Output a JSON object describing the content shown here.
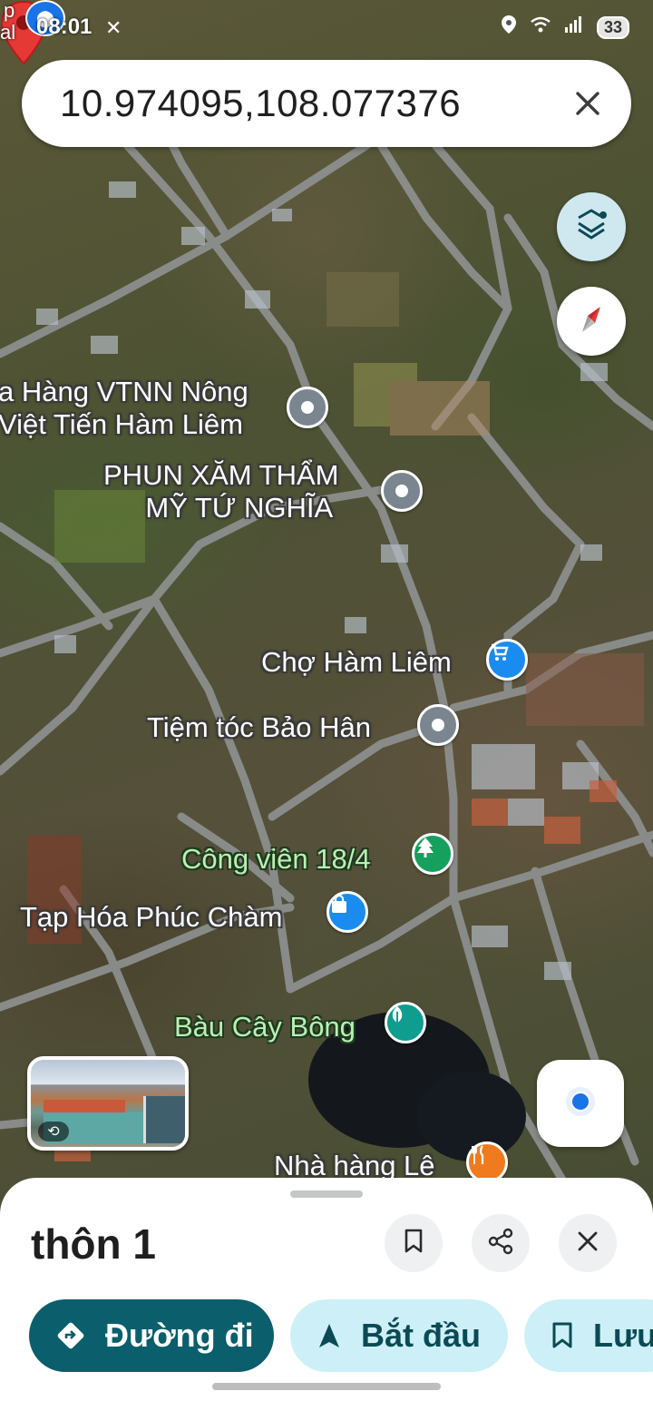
{
  "status_bar": {
    "time": "08:01",
    "crumb_top": "p",
    "crumb_bottom": "al",
    "battery": "33"
  },
  "search": {
    "query": "10.974095,108.077376",
    "close_icon": "close-icon"
  },
  "map": {
    "labels": [
      {
        "id": "vtnn",
        "line1": "a Hàng VTNN Nông",
        "line2": "Việt Tiến Hàm Liêm",
        "pin": "gray"
      },
      {
        "id": "phun-xam",
        "line1": "PHUN XĂM THẨM",
        "line2": "MỸ TỨ NGHĨA",
        "pin": "gray"
      },
      {
        "id": "cho",
        "text": "Chợ Hàm Liêm",
        "pin": "shopping-cart"
      },
      {
        "id": "tiem-toc",
        "text": "Tiệm tóc Bảo Hân",
        "pin": "gray"
      },
      {
        "id": "cong-vien",
        "text": "Công viên 18/4",
        "pin": "tree"
      },
      {
        "id": "tap-hoa",
        "text": "Tạp Hóa Phúc Chàm",
        "pin": "shopping-bag"
      },
      {
        "id": "bau-cay-bong",
        "text": "Bàu Cây Bông",
        "pin": "leaf"
      },
      {
        "id": "nha-hang",
        "text": "Nhà hàng Lê",
        "pin": "restaurant"
      }
    ]
  },
  "colors": {
    "primary_chip": "#0b5e6b",
    "secondary_chip": "#cdf0f8",
    "marker_red": "#e53935"
  },
  "sheet": {
    "title": "thôn 1",
    "chips": {
      "directions": "Đường đi",
      "start": "Bắt đầu",
      "save": "Lưu"
    }
  }
}
